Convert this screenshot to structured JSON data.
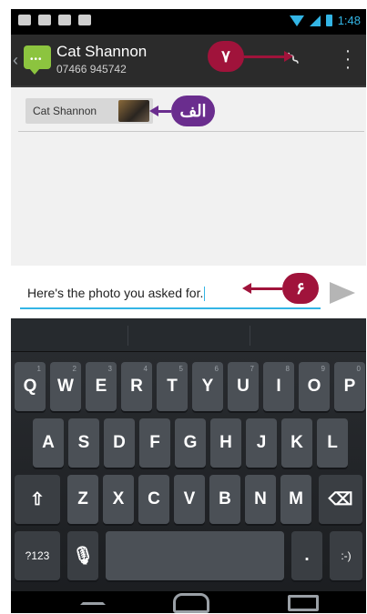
{
  "status_bar": {
    "time": "1:48"
  },
  "action_bar": {
    "contact_name": "Cat Shannon",
    "contact_phone": "07466 945742",
    "app_icon": "messaging-icon",
    "attach_icon": "paperclip-icon",
    "overflow_icon": "more-vertical-icon"
  },
  "recipient": {
    "chip_name": "Cat Shannon"
  },
  "compose": {
    "text": "Here's the photo you asked for.",
    "send_icon": "send-icon"
  },
  "keyboard": {
    "row1": [
      {
        "label": "Q",
        "hint": "1"
      },
      {
        "label": "W",
        "hint": "2"
      },
      {
        "label": "E",
        "hint": "3"
      },
      {
        "label": "R",
        "hint": "4"
      },
      {
        "label": "T",
        "hint": "5"
      },
      {
        "label": "Y",
        "hint": "6"
      },
      {
        "label": "U",
        "hint": "7"
      },
      {
        "label": "I",
        "hint": "8"
      },
      {
        "label": "O",
        "hint": "9"
      },
      {
        "label": "P",
        "hint": "0"
      }
    ],
    "row2": [
      "A",
      "S",
      "D",
      "F",
      "G",
      "H",
      "J",
      "K",
      "L"
    ],
    "row3": [
      "Z",
      "X",
      "C",
      "V",
      "B",
      "N",
      "M"
    ],
    "symbols_label": "?123",
    "period_label": ".",
    "smiley_label": ":-)",
    "shift_icon": "shift-icon",
    "mic_icon": "microphone-icon",
    "delete_icon": "backspace-icon"
  },
  "nav": {
    "back_icon": "nav-back-icon",
    "home_icon": "nav-home-icon",
    "recents_icon": "nav-recents-icon"
  },
  "callouts": {
    "attach": "٧",
    "recipient": "الف",
    "compose": "۶",
    "color": "#a0133b",
    "recipient_color": "#6a2d8e"
  }
}
